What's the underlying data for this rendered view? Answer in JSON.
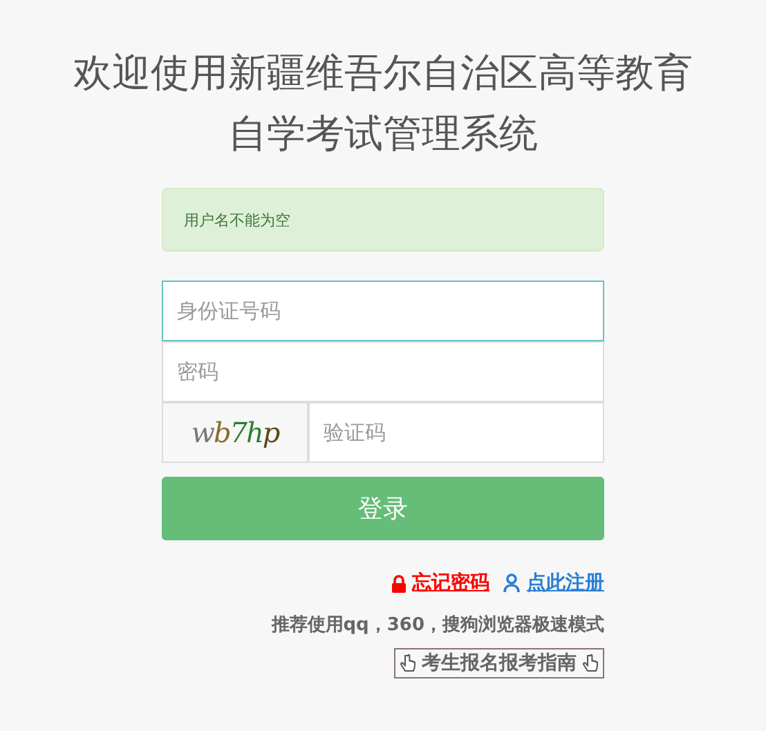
{
  "title_lines": [
    "欢迎使用新疆维吾尔自治区高等教育",
    "自学考试管理系统"
  ],
  "alert": {
    "text": "用户名不能为空"
  },
  "fields": [
    {
      "kind": "text",
      "placeholder": "身份证号码",
      "focused": true
    },
    {
      "kind": "password",
      "placeholder": "密码",
      "focused": false
    },
    {
      "kind": "captcha",
      "captcha": "wb7hp",
      "placeholder": "验证码",
      "focused": false
    }
  ],
  "login_button": "登录",
  "links": [
    {
      "kind": "lock",
      "label": "忘记密码",
      "color": "#ff0000"
    },
    {
      "kind": "user",
      "label": "点此注册",
      "color": "#2a7fd4"
    }
  ],
  "recommend": "推荐使用qq，360，搜狗浏览器极速模式",
  "guide": "考生报名报考指南"
}
